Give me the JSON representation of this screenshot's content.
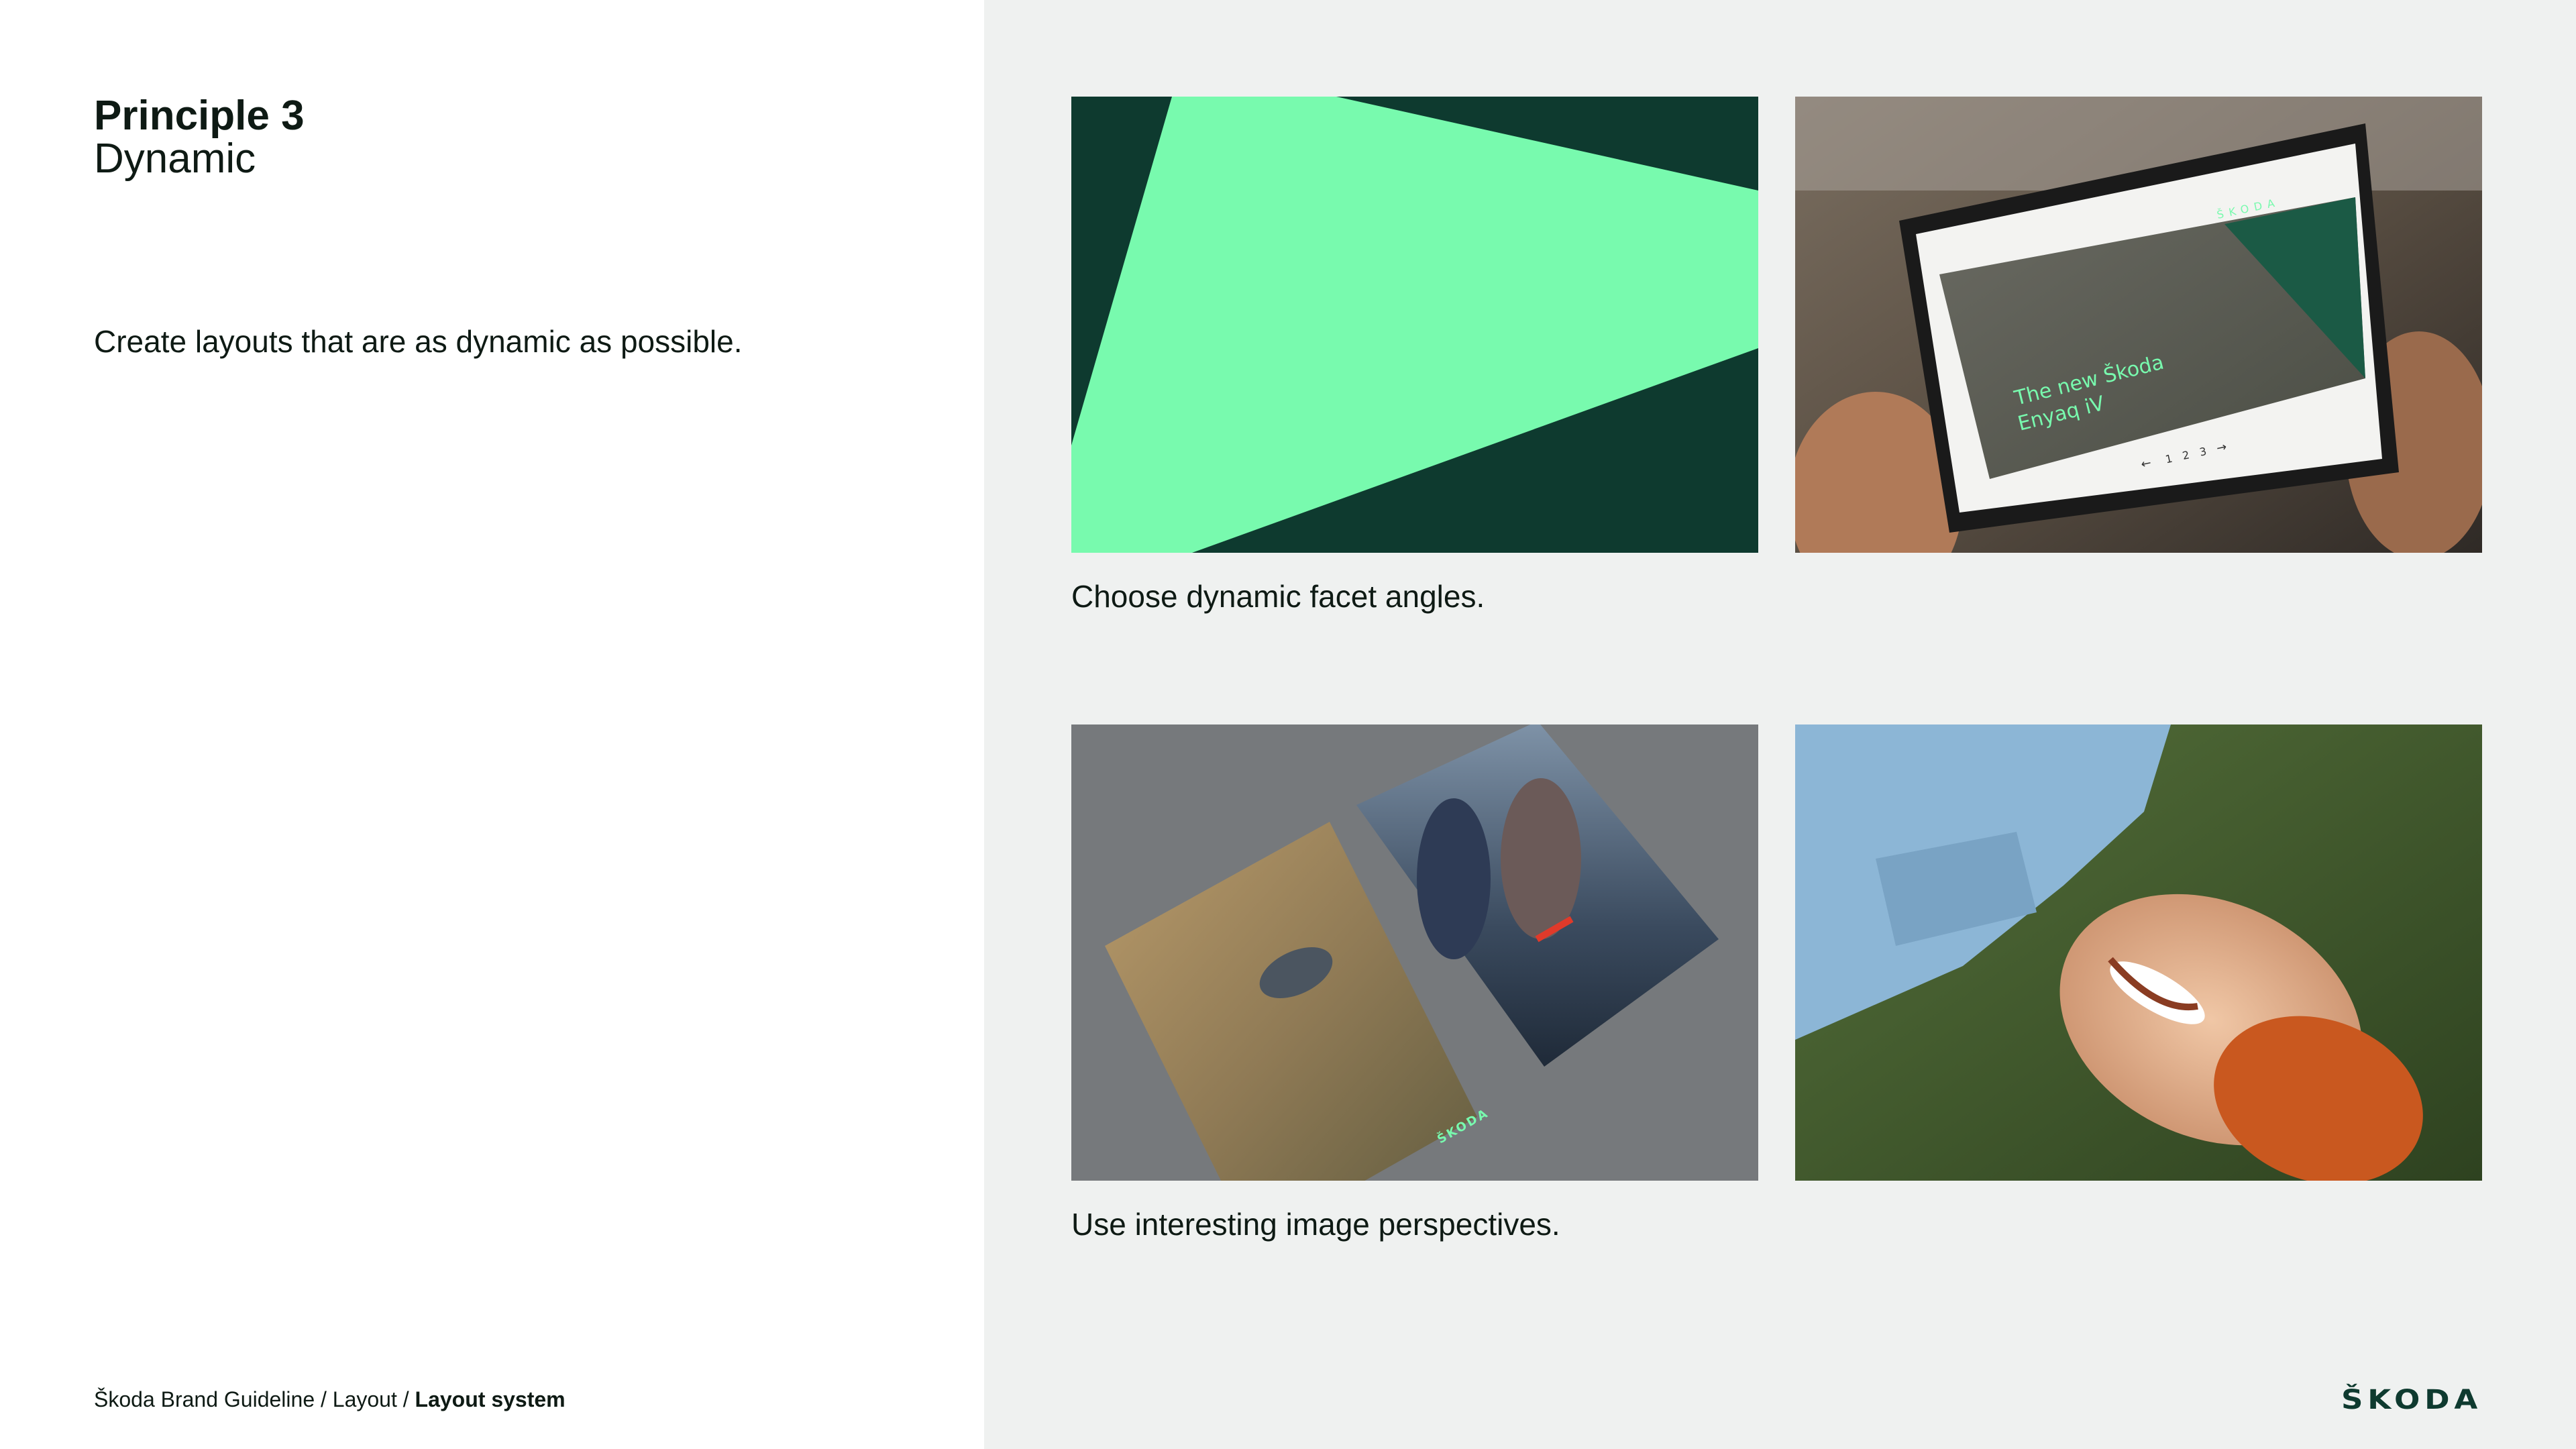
{
  "page": {
    "principle_title": "Principle 3",
    "principle_subtitle": "Dynamic",
    "description": "Create layouts that are as dynamic as possible."
  },
  "footer": {
    "breadcrumb_prefix": "Škoda Brand Guideline / Layout /",
    "breadcrumb_current": "Layout system",
    "logo_text": "ŠKODA"
  },
  "examples": [
    {
      "caption": "Choose dynamic facet angles.",
      "images": [
        "facet-graphic",
        "tablet-photo"
      ],
      "tablet_screen": {
        "brand": "ŠKODA",
        "headline_line1": "The new Škoda",
        "headline_line2": "Enyaq iV",
        "pager": [
          "1",
          "2",
          "3"
        ]
      }
    },
    {
      "caption": "Use interesting image perspectives.",
      "images": [
        "brochures-photo",
        "smiling-man-photo"
      ],
      "brochure_brand": "ŠKODA"
    }
  ],
  "colors": {
    "dark_green": "#0e3a2f",
    "electric_green": "#78faae",
    "panel_grey": "#eff1f0",
    "text": "#0e1a14"
  }
}
